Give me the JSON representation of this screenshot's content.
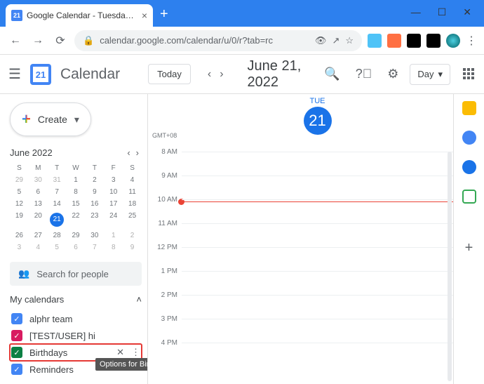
{
  "browser": {
    "tab_title": "Google Calendar - Tuesday, June",
    "url": "calendar.google.com/calendar/u/0/r?tab=rc"
  },
  "header": {
    "app_name": "Calendar",
    "today_label": "Today",
    "date_title": "June 21, 2022",
    "view_label": "Day"
  },
  "sidebar": {
    "create_label": "Create",
    "mini_cal": {
      "month_label": "June 2022",
      "dow": [
        "S",
        "M",
        "T",
        "W",
        "T",
        "F",
        "S"
      ],
      "weeks": [
        [
          {
            "d": 29,
            "dim": true
          },
          {
            "d": 30,
            "dim": true
          },
          {
            "d": 31,
            "dim": true
          },
          {
            "d": 1
          },
          {
            "d": 2
          },
          {
            "d": 3
          },
          {
            "d": 4
          }
        ],
        [
          {
            "d": 5
          },
          {
            "d": 6
          },
          {
            "d": 7
          },
          {
            "d": 8
          },
          {
            "d": 9
          },
          {
            "d": 10
          },
          {
            "d": 11
          }
        ],
        [
          {
            "d": 12
          },
          {
            "d": 13
          },
          {
            "d": 14
          },
          {
            "d": 15
          },
          {
            "d": 16
          },
          {
            "d": 17
          },
          {
            "d": 18
          }
        ],
        [
          {
            "d": 19
          },
          {
            "d": 20
          },
          {
            "d": 21,
            "today": true
          },
          {
            "d": 22
          },
          {
            "d": 23
          },
          {
            "d": 24
          },
          {
            "d": 25
          }
        ],
        [
          {
            "d": 26
          },
          {
            "d": 27
          },
          {
            "d": 28
          },
          {
            "d": 29
          },
          {
            "d": 30
          },
          {
            "d": 1,
            "dim": true
          },
          {
            "d": 2,
            "dim": true
          }
        ],
        [
          {
            "d": 3,
            "dim": true
          },
          {
            "d": 4,
            "dim": true
          },
          {
            "d": 5,
            "dim": true
          },
          {
            "d": 6,
            "dim": true
          },
          {
            "d": 7,
            "dim": true
          },
          {
            "d": 8,
            "dim": true
          },
          {
            "d": 9,
            "dim": true
          }
        ]
      ]
    },
    "search_placeholder": "Search for people",
    "my_calendars_label": "My calendars",
    "calendars": [
      {
        "name": "alphr team",
        "color": "#4285f4",
        "checked": true
      },
      {
        "name": "[TEST/USER] hi",
        "color": "#d81b60",
        "checked": true
      },
      {
        "name": "Birthdays",
        "color": "#0b8043",
        "checked": true,
        "hover": true
      },
      {
        "name": "Reminders",
        "color": "#4285f4",
        "checked": true
      }
    ],
    "tooltip": "Options for Birthdays"
  },
  "day": {
    "tz": "GMT+08",
    "dow": "TUE",
    "date": "21",
    "hours": [
      "8 AM",
      "9 AM",
      "10 AM",
      "11 AM",
      "12 PM",
      "1 PM",
      "2 PM",
      "3 PM",
      "4 PM"
    ]
  }
}
